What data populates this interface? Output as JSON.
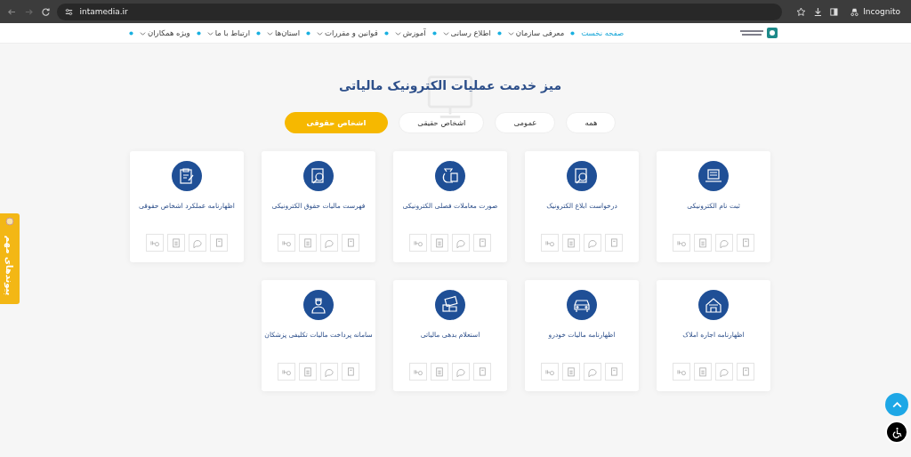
{
  "browser": {
    "url": "intamedia.ir",
    "mode": "Incognito"
  },
  "nav": [
    {
      "label": "صفحه نخست",
      "selected": true,
      "dropdown": false
    },
    {
      "label": "معرفی سازمان",
      "selected": false,
      "dropdown": true
    },
    {
      "label": "اطلاع رسانی",
      "selected": false,
      "dropdown": true
    },
    {
      "label": "آموزش",
      "selected": false,
      "dropdown": true
    },
    {
      "label": "قوانین و مقررات",
      "selected": false,
      "dropdown": true
    },
    {
      "label": "استان‌ها",
      "selected": false,
      "dropdown": true
    },
    {
      "label": "ارتباط با ما",
      "selected": false,
      "dropdown": true
    },
    {
      "label": "ویژه همکاران",
      "selected": false,
      "dropdown": true
    }
  ],
  "heading": "میز خدمت عملیات الکترونیک مالیاتی",
  "filters": [
    {
      "label": "همه",
      "selected": false
    },
    {
      "label": "عمومی",
      "selected": false
    },
    {
      "label": "اشخاص حقیقی",
      "selected": false
    },
    {
      "label": "اشخاص حقوقی",
      "selected": true
    }
  ],
  "services": [
    {
      "title": "ثبت نام الکترونیکی"
    },
    {
      "title": "درخواست ابلاغ الکترونیک"
    },
    {
      "title": "صورت معاملات فصلی الکترونیکی"
    },
    {
      "title": "فهرست مالیات حقوق الکترونیکی"
    },
    {
      "title": "اظهارنامه عملکرد اشخاص حقوقی"
    },
    {
      "title": "اظهارنامه اجاره املاک"
    },
    {
      "title": "اظهارنامه مالیات خودرو"
    },
    {
      "title": "استعلام بدهی مالیاتی"
    },
    {
      "title": "سامانه پرداخت مالیات تکلیفی پزشکان"
    }
  ],
  "side_tab": "پیوندهای مهم"
}
